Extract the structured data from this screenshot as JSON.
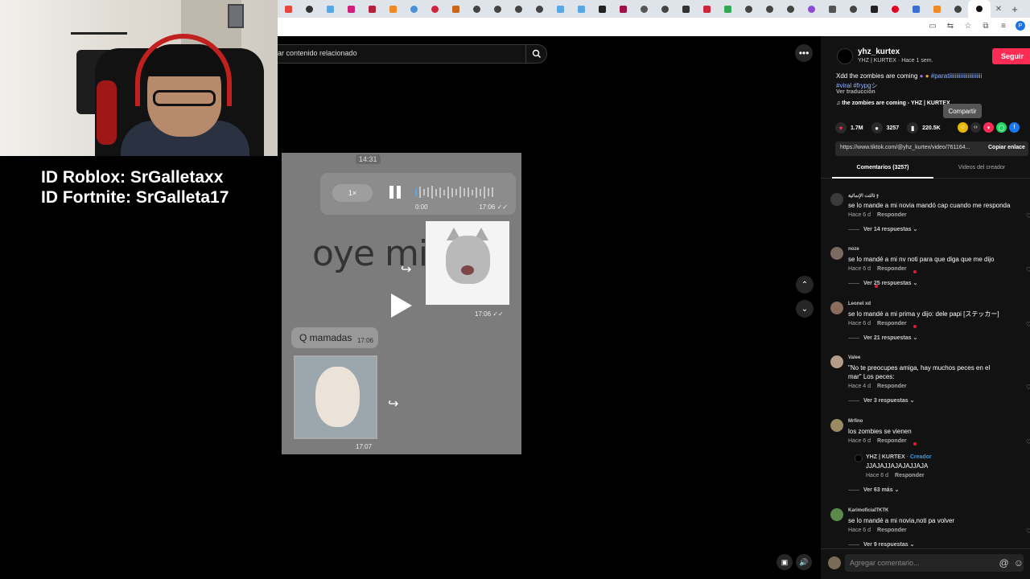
{
  "overlay": {
    "line1": "ID Roblox: SrGalletaxx",
    "line2": "ID Fortnite: SrGalleta17"
  },
  "search": {
    "placeholder_visible": "ar contenido relacionado"
  },
  "video": {
    "time_top": "14:31",
    "speed": "1×",
    "audio_elapsed": "0:00",
    "audio_sent": "17:06",
    "big_text": "oye mija",
    "cat_time": "17:06",
    "reply_text": "Q mamadas",
    "reply_time": "17:06",
    "dog_time": "17:07"
  },
  "post": {
    "username": "yhz_kurtex",
    "subline": "YHZ | KURTEX · Hace 1 sem.",
    "follow_label": "Seguir",
    "desc_plain": "Xdd the zombies are coming ",
    "desc_hash1": "#paratiiiiiiiiiiiiiiiiiiiiiii",
    "desc_hash2": "#viral",
    "desc_hash3": "#frypgシ",
    "translate_label": "Ver traducción",
    "music": "♫  the zombies are coming - YHZ | KURTEX",
    "tooltip": "Compartir",
    "likes": "1.7M",
    "comments_count": "3257",
    "saves": "220.5K",
    "link": "https://www.tiktok.com/@yhz_kurtex/video/761164...",
    "copy_label": "Copiar enlace",
    "tab_comments": "Comentarios (3257)",
    "tab_creator": "Videos del creador"
  },
  "comments": [
    {
      "name": "ثالثت الإتمائية ჯ",
      "text": "se lo mande a mi novia mandó cap cuando me responda",
      "meta": "Hace 6 d",
      "reply": "Responder",
      "more": "Ver 14 respuestas ⌄",
      "color": "#3b3b3b"
    },
    {
      "name": "noze",
      "text": "se lo mandé a mi nv noti para que diga que me dijo",
      "meta": "Hace 6 d",
      "reply": "Responder",
      "more": "Ver 25 respuestas ⌄",
      "color": "#7a6a62"
    },
    {
      "name": "Leonel xd",
      "text": "se lo mandé a mi prima y dijo: dele papi [ステッカー]",
      "meta": "Hace 6 d",
      "reply": "Responder",
      "more": "Ver 21 respuestas ⌄",
      "color": "#8a6b5c"
    },
    {
      "name": "Valee",
      "text": "\"No te preocupes amiga, hay muchos peces en el mar\" Los peces:",
      "meta": "Hace 4 d",
      "reply": "Responder",
      "more": "Ver 3 respuestas ⌄",
      "color": "#b59c88"
    },
    {
      "name": "Mrfino",
      "text": "los zombies se vienen",
      "meta": "Hace 6 d",
      "reply": "Responder",
      "more": "Ver 63 más ⌄",
      "color": "#9a8a62"
    },
    {
      "name": "KarimoficialTKTK",
      "text": "se lo mandé a mi novia,noti pa volver",
      "meta": "Hace 6 d",
      "reply": "Responder",
      "more": "Ver 9 respuestas ⌄",
      "color": "#5a8a4a"
    }
  ],
  "creator_reply": {
    "name": "YHZ | KURTEX",
    "tag": " · Creador",
    "text": "JJAJAJJAJAJAJJAJA",
    "meta": "Hace 6 d",
    "reply": "Responder"
  },
  "input": {
    "placeholder": "Agregar comentario..."
  },
  "colors": {
    "accent": "#fe2c55",
    "creator_tag": "#2f9bf0"
  }
}
